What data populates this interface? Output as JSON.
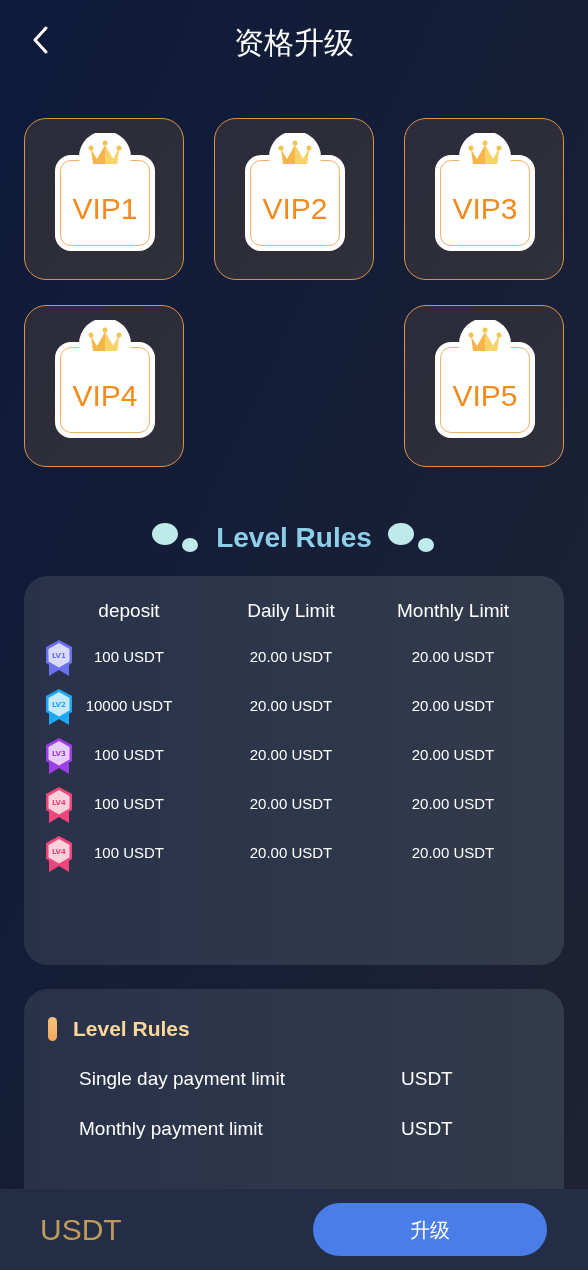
{
  "header": {
    "title": "资格升级"
  },
  "vip_levels": [
    {
      "label": "VIP1"
    },
    {
      "label": "VIP2"
    },
    {
      "label": "VIP3"
    },
    {
      "label": "VIP4"
    },
    {
      "label": "VIP5"
    }
  ],
  "rules_heading": "Level Rules",
  "rules_table": {
    "columns": [
      "deposit",
      "Daily Limit",
      "Monthly Limit"
    ],
    "rows": [
      {
        "badge": "LV1",
        "color": "#6b70ee",
        "deposit": "100 USDT",
        "daily": "20.00 USDT",
        "monthly": "20.00 USDT"
      },
      {
        "badge": "LV2",
        "color": "#1ea7f2",
        "deposit": "10000 USDT",
        "daily": "20.00 USDT",
        "monthly": "20.00 USDT"
      },
      {
        "badge": "LV3",
        "color": "#9c3fe6",
        "deposit": "100 USDT",
        "daily": "20.00 USDT",
        "monthly": "20.00 USDT"
      },
      {
        "badge": "LV4",
        "color": "#f0457a",
        "deposit": "100 USDT",
        "daily": "20.00 USDT",
        "monthly": "20.00 USDT"
      },
      {
        "badge": "LV4",
        "color": "#f0457a",
        "deposit": "100 USDT",
        "daily": "20.00 USDT",
        "monthly": "20.00 USDT"
      }
    ]
  },
  "limits_card": {
    "title": "Level Rules",
    "items": [
      {
        "label": "Single day payment limit",
        "value": "USDT"
      },
      {
        "label": "Monthly payment limit",
        "value": "USDT"
      }
    ]
  },
  "bottom_bar": {
    "amount": "USDT",
    "button": "升级"
  }
}
